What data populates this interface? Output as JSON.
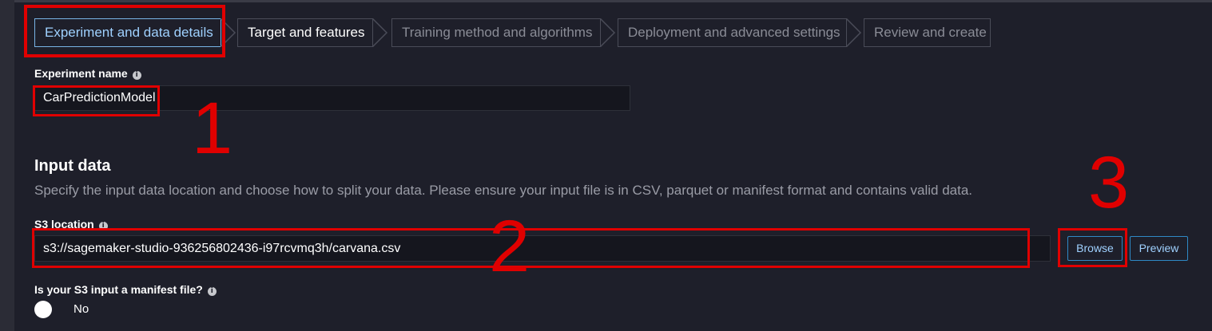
{
  "stepper": {
    "steps": [
      {
        "label": "Experiment and data details",
        "state": "active"
      },
      {
        "label": "Target and features",
        "state": "done"
      },
      {
        "label": "Training method and algorithms",
        "state": "pending"
      },
      {
        "label": "Deployment and advanced settings",
        "state": "pending"
      },
      {
        "label": "Review and create",
        "state": "pending"
      }
    ]
  },
  "experiment": {
    "label": "Experiment name",
    "value": "CarPredictionModel"
  },
  "input_data": {
    "title": "Input data",
    "description": "Specify the input data location and choose how to split your data. Please ensure your input file is in CSV, parquet or manifest format and contains valid data.",
    "s3_label": "S3 location",
    "s3_value": "s3://sagemaker-studio-936256802436-i97rcvmq3h/carvana.csv",
    "browse_label": "Browse",
    "preview_label": "Preview",
    "manifest_question": "Is your S3 input a manifest file?",
    "manifest_value": "No"
  },
  "annotations": [
    "1",
    "2",
    "3"
  ],
  "colors": {
    "background": "#1e1f2a",
    "accent": "#9fd1ff",
    "annotation": "#e00000"
  }
}
